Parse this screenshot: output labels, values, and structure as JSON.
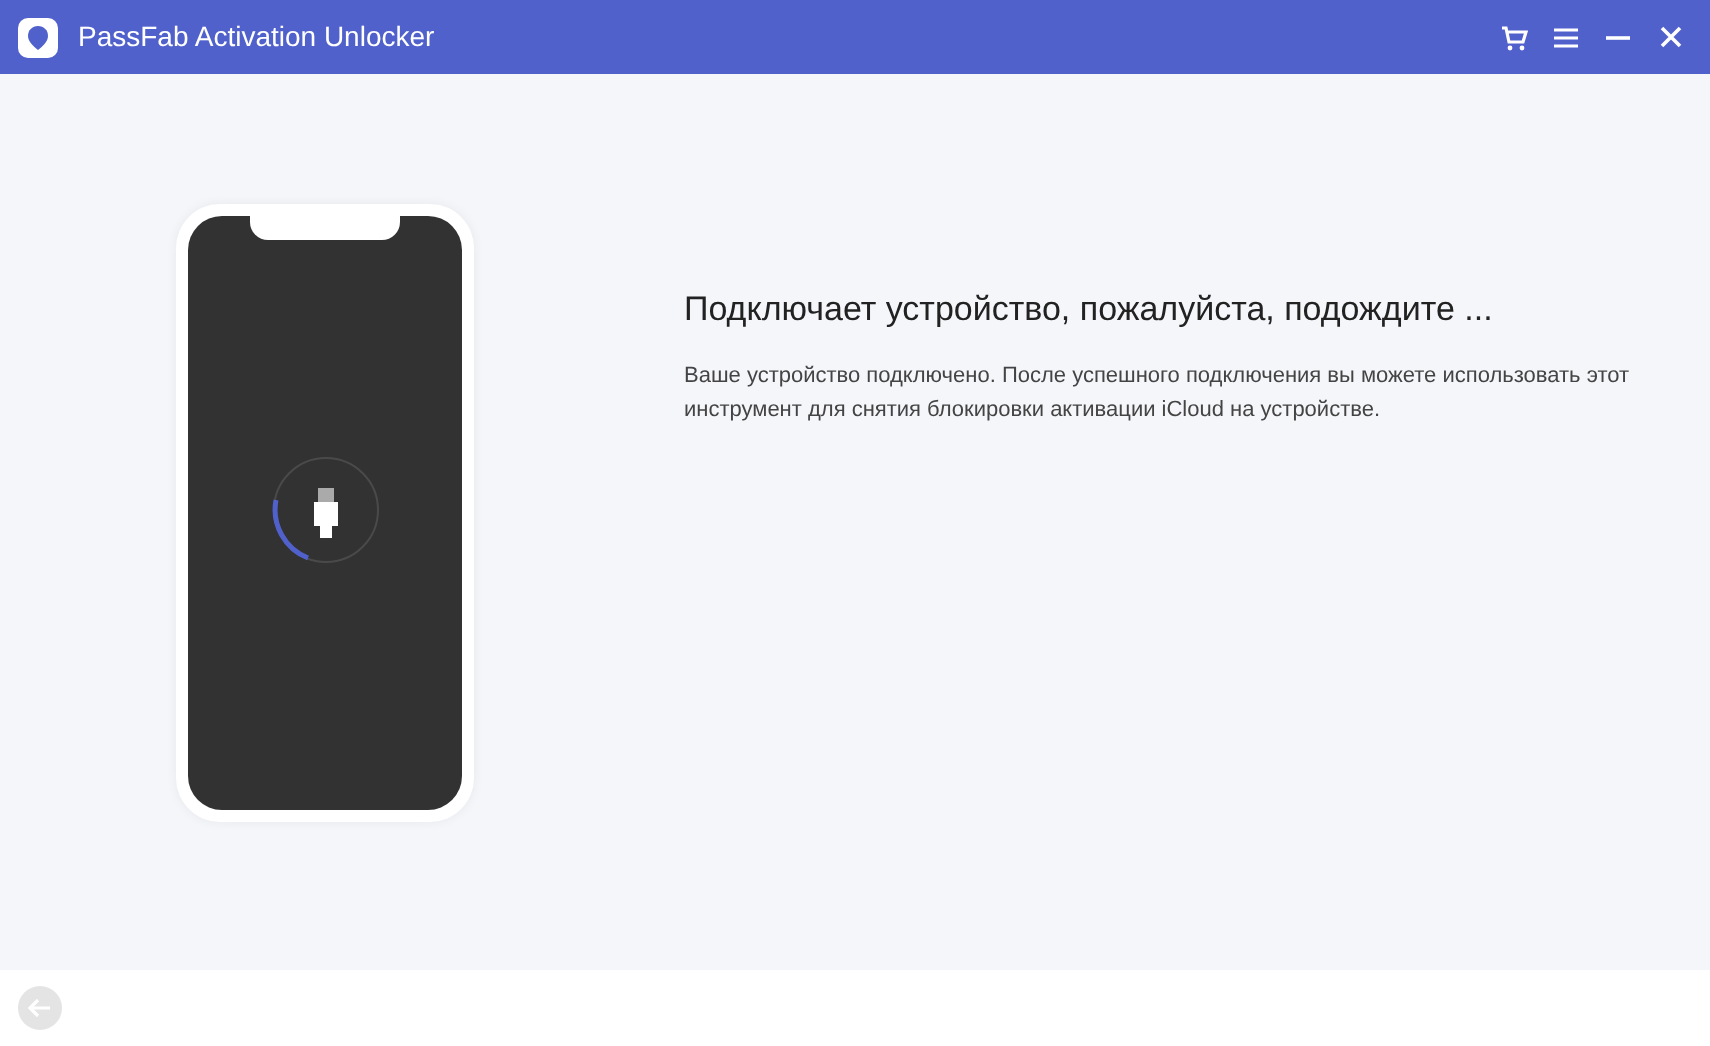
{
  "window": {
    "title": "PassFab Activation Unlocker"
  },
  "status": {
    "heading": "Подключает устройство, пожалуйста, подождите ...",
    "description": "Ваше устройство подключено. После успешного подключения вы можете использовать этот инструмент для снятия блокировки активации iCloud на устройстве."
  },
  "footer": {
    "back_button": {
      "disabled": true
    }
  }
}
